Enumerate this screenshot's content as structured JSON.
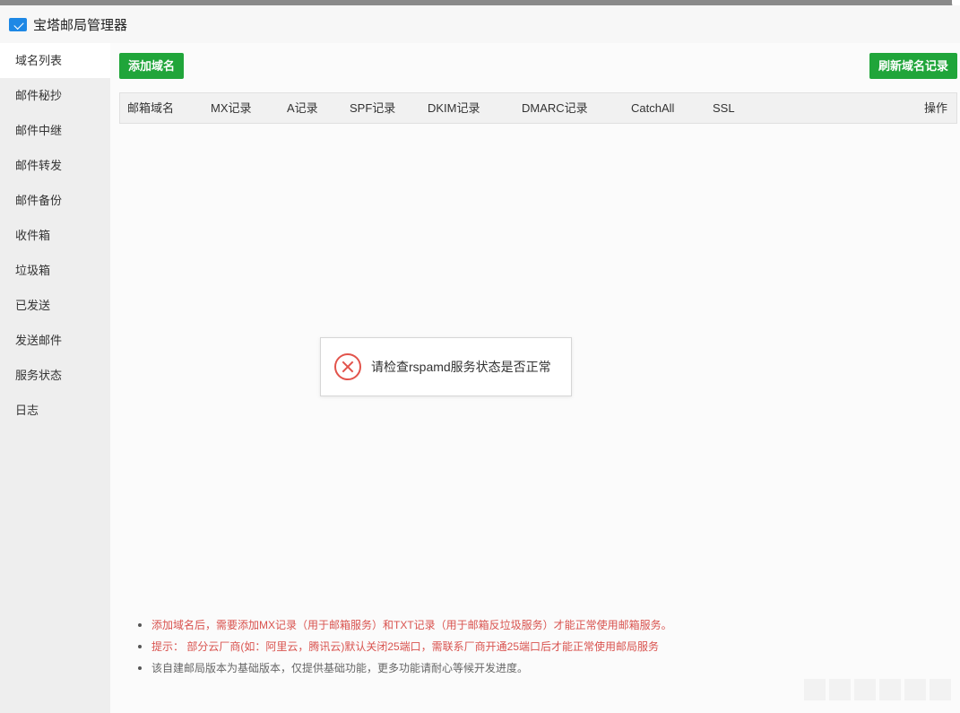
{
  "window": {
    "title": "宝塔邮局管理器"
  },
  "sidebar": {
    "items": [
      {
        "label": "域名列表",
        "active": true
      },
      {
        "label": "邮件秘抄"
      },
      {
        "label": "邮件中继"
      },
      {
        "label": "邮件转发"
      },
      {
        "label": "邮件备份"
      },
      {
        "label": "收件箱"
      },
      {
        "label": "垃圾箱"
      },
      {
        "label": "已发送"
      },
      {
        "label": "发送邮件"
      },
      {
        "label": "服务状态"
      },
      {
        "label": "日志"
      }
    ]
  },
  "toolbar": {
    "add_domain_label": "添加域名",
    "refresh_label": "刷新域名记录"
  },
  "table": {
    "columns": [
      "邮箱域名",
      "MX记录",
      "A记录",
      "SPF记录",
      "DKIM记录",
      "DMARC记录",
      "CatchAll",
      "SSL",
      "操作"
    ]
  },
  "notes": [
    {
      "text": "添加域名后，需要添加MX记录（用于邮箱服务）和TXT记录（用于邮箱反垃圾服务）才能正常使用邮箱服务。",
      "color": "#d9534f"
    },
    {
      "text": "提示： 部分云厂商(如：阿里云，腾讯云)默认关闭25端口，需联系厂商开通25端口后才能正常使用邮局服务",
      "color": "#d9534f"
    },
    {
      "text": "该自建邮局版本为基础版本，仅提供基础功能，更多功能请耐心等候开发进度。",
      "color": "#666666"
    }
  ],
  "toast": {
    "message": "请检查rspamd服务状态是否正常",
    "icon": "error-circle-icon",
    "color": "#e2534b"
  },
  "colors": {
    "accent_green": "#20a53a",
    "sidebar_bg": "#eeeeee",
    "notice_red": "#d9534f"
  }
}
